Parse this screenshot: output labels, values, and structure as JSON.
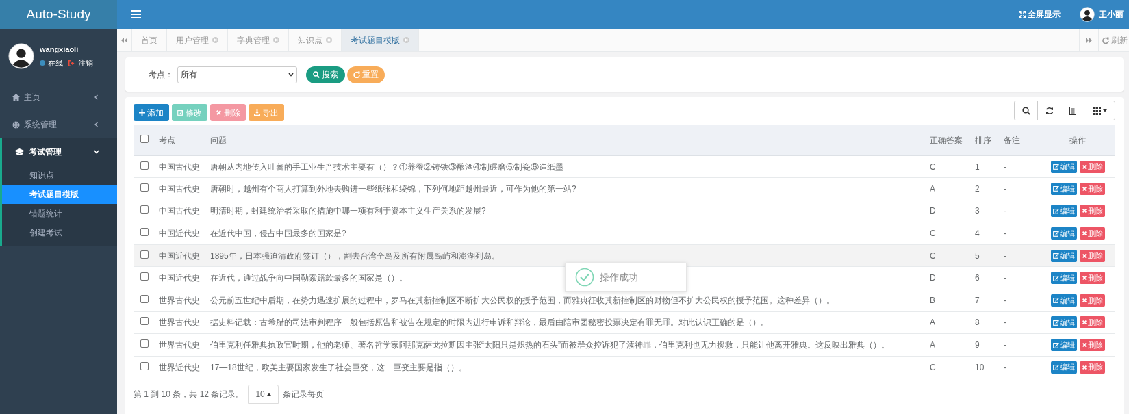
{
  "app": {
    "title": "Auto-Study"
  },
  "topbar": {
    "fullscreen": "全屏显示",
    "user": "王小丽"
  },
  "sidebar": {
    "username": "wangxiaoli",
    "status": "在线",
    "online": true,
    "logout": "注销",
    "items": [
      {
        "label": "主页",
        "expanded": false
      },
      {
        "label": "系统管理",
        "expanded": false
      },
      {
        "label": "考试管理",
        "expanded": true,
        "children": [
          {
            "label": "知识点",
            "selected": false
          },
          {
            "label": "考试题目模版",
            "selected": true
          },
          {
            "label": "错题统计",
            "selected": false
          },
          {
            "label": "创建考试",
            "selected": false
          }
        ]
      }
    ]
  },
  "tabs": [
    {
      "label": "首页",
      "selected": false,
      "closable": false
    },
    {
      "label": "用户管理",
      "selected": false,
      "closable": true
    },
    {
      "label": "字典管理",
      "selected": false,
      "closable": true
    },
    {
      "label": "知识点",
      "selected": false,
      "closable": true
    },
    {
      "label": "考试题目模版",
      "selected": true,
      "closable": true
    }
  ],
  "refresh": "刷新",
  "filter": {
    "label": "考点：",
    "value": "所有",
    "search": "搜索",
    "reset": "重置"
  },
  "toolbar": [
    {
      "label": "添加",
      "kind": "add",
      "disabled": false
    },
    {
      "label": "修改",
      "kind": "edit",
      "disabled": true
    },
    {
      "label": "删除",
      "kind": "delete",
      "disabled": true
    },
    {
      "label": "导出",
      "kind": "export",
      "disabled": false
    }
  ],
  "table": {
    "header_checked": false,
    "columns": [
      "考点",
      "问题",
      "正确答案",
      "排序",
      "备注",
      "操作"
    ],
    "rows": [
      {
        "checked": false,
        "highlighted": false,
        "topic": "中国古代史",
        "question": "唐朝从内地传入吐蕃的手工业生产技术主要有（）？①养蚕②铸铁③酿酒④制碾磨⑤制瓷⑥造纸墨",
        "answer": "C",
        "order": "1",
        "note": "-",
        "edit": "编辑",
        "delete": "删除"
      },
      {
        "checked": false,
        "highlighted": false,
        "topic": "中国古代史",
        "question": "唐朝时，越州有个商人打算到外地去购进一些纸张和绫锦，下列何地距越州最近，可作为他的第一站?",
        "answer": "A",
        "order": "2",
        "note": "-",
        "edit": "编辑",
        "delete": "删除"
      },
      {
        "checked": false,
        "highlighted": false,
        "topic": "中国古代史",
        "question": "明清时期，封建统治者采取的措施中哪一项有利于资本主义生产关系的发展?",
        "answer": "D",
        "order": "3",
        "note": "-",
        "edit": "编辑",
        "delete": "删除"
      },
      {
        "checked": false,
        "highlighted": false,
        "topic": "中国近代史",
        "question": "在近代中国，侵占中国最多的国家是?",
        "answer": "C",
        "order": "4",
        "note": "-",
        "edit": "编辑",
        "delete": "删除"
      },
      {
        "checked": false,
        "highlighted": true,
        "topic": "中国近代史",
        "question": "1895年，日本强迫清政府签订（），割去台湾全岛及所有附属岛屿和澎湖列岛。",
        "answer": "C",
        "order": "5",
        "note": "-",
        "edit": "编辑",
        "delete": "删除"
      },
      {
        "checked": false,
        "highlighted": false,
        "topic": "中国近代史",
        "question": "在近代，通过战争向中国勒索赔款最多的国家是（）。",
        "answer": "D",
        "order": "6",
        "note": "-",
        "edit": "编辑",
        "delete": "删除"
      },
      {
        "checked": false,
        "highlighted": false,
        "topic": "世界古代史",
        "question": "公元前五世纪中后期，在势力迅速扩展的过程中，罗马在其新控制区不断扩大公民权的授予范围，而雅典征收其新控制区的财物但不扩大公民权的授予范围。这种差异（）。",
        "answer": "B",
        "order": "7",
        "note": "-",
        "edit": "编辑",
        "delete": "删除"
      },
      {
        "checked": false,
        "highlighted": false,
        "topic": "世界古代史",
        "question": "据史料记载：古希腊的司法审判程序一般包括原告和被告在规定的时限内进行申诉和辩论，最后由陪审团秘密投票决定有罪无罪。对此认识正确的是（）。",
        "answer": "A",
        "order": "8",
        "note": "-",
        "edit": "编辑",
        "delete": "删除"
      },
      {
        "checked": false,
        "highlighted": false,
        "topic": "世界古代史",
        "question": "伯里克利任雅典执政官时期，他的老师、著名哲学家阿那克萨戈拉斯因主张“太阳只是炽热的石头”而被群众控诉犯了渎神罪，伯里克利也无力援救，只能让他离开雅典。这反映出雅典（）。",
        "answer": "A",
        "order": "9",
        "note": "-",
        "edit": "编辑",
        "delete": "删除"
      },
      {
        "checked": false,
        "highlighted": false,
        "topic": "世界近代史",
        "question": "17—18世纪，欧美主要国家发生了社会巨变，这一巨变主要是指（）。",
        "answer": "C",
        "order": "10",
        "note": "-",
        "edit": "编辑",
        "delete": "删除"
      }
    ]
  },
  "pagination": {
    "summary": "第 1 到 10 条，共 12 条记录。",
    "page_size": "10",
    "per_page": "条记录每页"
  },
  "toast": {
    "message": "操作成功"
  }
}
